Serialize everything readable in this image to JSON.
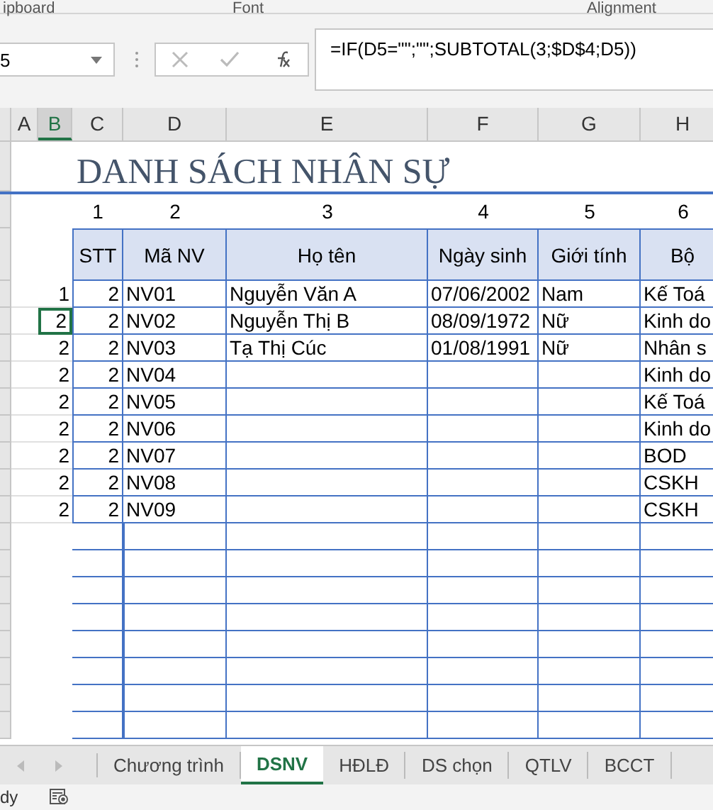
{
  "ribbon": {
    "groups": [
      "ipboard",
      "Font",
      "Alignment"
    ]
  },
  "name_box": {
    "value": "5"
  },
  "formula_bar": {
    "value": "=IF(D5=\"\";\"\";SUBTOTAL(3;$D$4;D5))"
  },
  "columns": [
    {
      "label": "A",
      "selected": false
    },
    {
      "label": "B",
      "selected": true
    },
    {
      "label": "C",
      "selected": false
    },
    {
      "label": "D",
      "selected": false
    },
    {
      "label": "E",
      "selected": false
    },
    {
      "label": "F",
      "selected": false
    },
    {
      "label": "G",
      "selected": false
    },
    {
      "label": "H",
      "selected": false
    }
  ],
  "sheet": {
    "title": "DANH SÁCH NHÂN SỰ",
    "column_numbers": [
      "1",
      "2",
      "3",
      "4",
      "5",
      "6"
    ],
    "headers": [
      "STT",
      "Mã NV",
      "Họ tên",
      "Ngày sinh",
      "Giới tính",
      "Bộ"
    ],
    "rows": [
      {
        "b": "1",
        "stt": "2",
        "ma_nv": "NV01",
        "ho_ten": "Nguyễn Văn A",
        "ngay_sinh": "07/06/2002",
        "gioi_tinh": "Nam",
        "bo_phan": "Kế Toá",
        "selected": false
      },
      {
        "b": "2",
        "stt": "2",
        "ma_nv": "NV02",
        "ho_ten": "Nguyễn Thị B",
        "ngay_sinh": "08/09/1972",
        "gioi_tinh": "Nữ",
        "bo_phan": "Kinh do",
        "selected": true
      },
      {
        "b": "2",
        "stt": "2",
        "ma_nv": "NV03",
        "ho_ten": "Tạ Thị Cúc",
        "ngay_sinh": "01/08/1991",
        "gioi_tinh": "Nữ",
        "bo_phan": "Nhân s",
        "selected": false
      },
      {
        "b": "2",
        "stt": "2",
        "ma_nv": "NV04",
        "ho_ten": "",
        "ngay_sinh": "",
        "gioi_tinh": "",
        "bo_phan": "Kinh do",
        "selected": false
      },
      {
        "b": "2",
        "stt": "2",
        "ma_nv": "NV05",
        "ho_ten": "",
        "ngay_sinh": "",
        "gioi_tinh": "",
        "bo_phan": "Kế Toá",
        "selected": false
      },
      {
        "b": "2",
        "stt": "2",
        "ma_nv": "NV06",
        "ho_ten": "",
        "ngay_sinh": "",
        "gioi_tinh": "",
        "bo_phan": "Kinh do",
        "selected": false
      },
      {
        "b": "2",
        "stt": "2",
        "ma_nv": "NV07",
        "ho_ten": "",
        "ngay_sinh": "",
        "gioi_tinh": "",
        "bo_phan": "BOD",
        "selected": false
      },
      {
        "b": "2",
        "stt": "2",
        "ma_nv": "NV08",
        "ho_ten": "",
        "ngay_sinh": "",
        "gioi_tinh": "",
        "bo_phan": "CSKH",
        "selected": false
      },
      {
        "b": "2",
        "stt": "2",
        "ma_nv": "NV09",
        "ho_ten": "",
        "ngay_sinh": "",
        "gioi_tinh": "",
        "bo_phan": "CSKH",
        "selected": false
      }
    ]
  },
  "sheet_tabs": [
    {
      "label": "Chương trình",
      "selected": false
    },
    {
      "label": "DSNV",
      "selected": true
    },
    {
      "label": "HĐLĐ",
      "selected": false
    },
    {
      "label": "DS chọn",
      "selected": false
    },
    {
      "label": "QTLV",
      "selected": false
    },
    {
      "label": "BCCT",
      "selected": false
    }
  ],
  "status_bar": {
    "text": "dy"
  }
}
